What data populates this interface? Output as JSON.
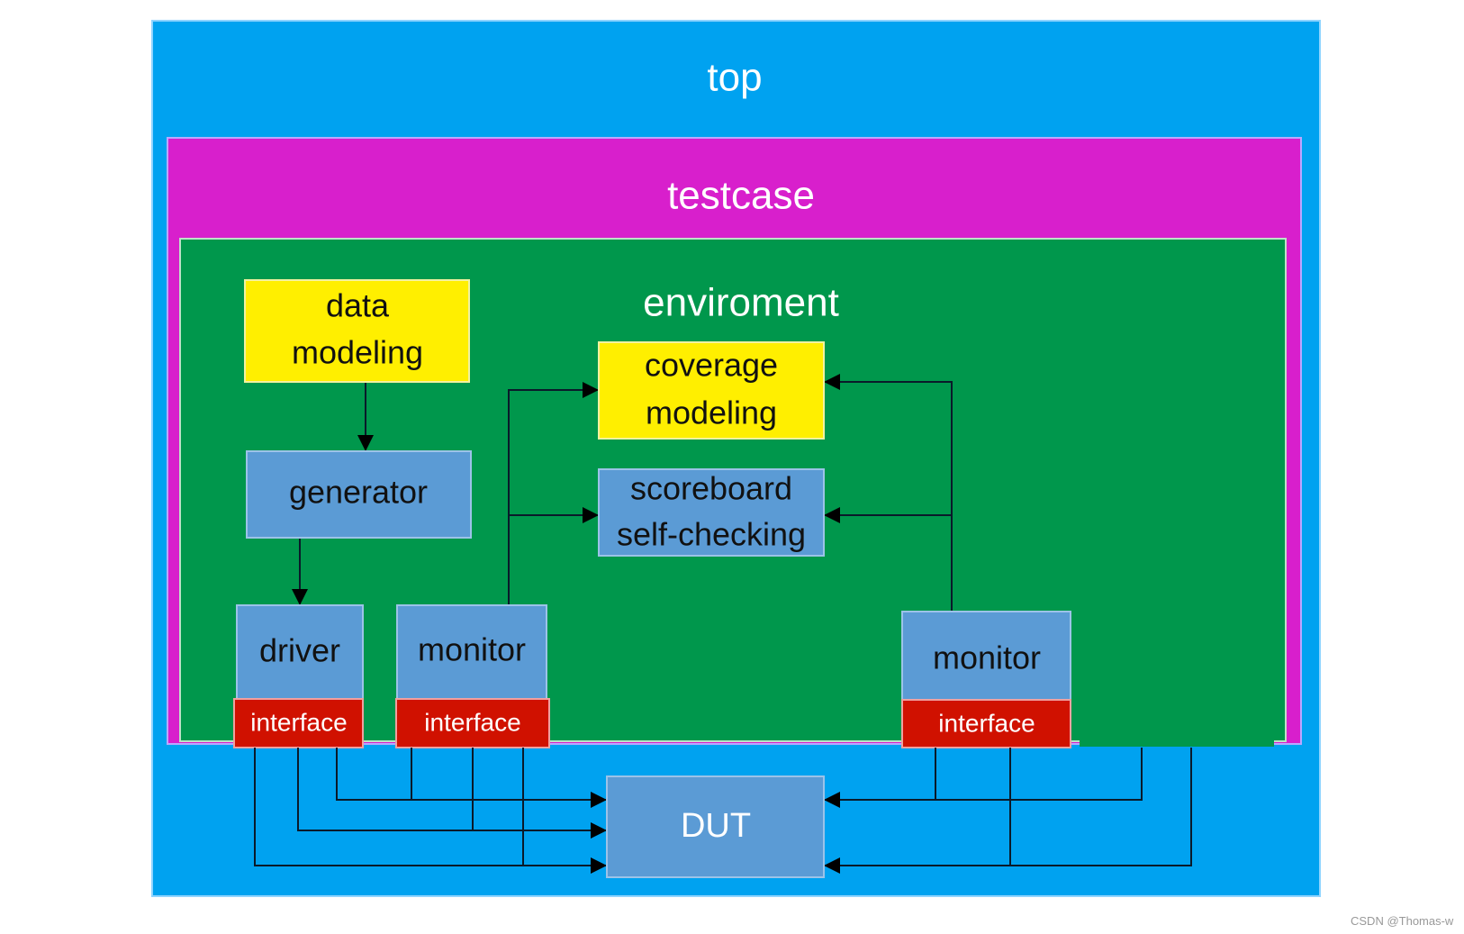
{
  "containers": {
    "top": "top",
    "testcase": "testcase",
    "environment": "enviroment"
  },
  "blocks": {
    "data_modeling": [
      "data",
      "modeling"
    ],
    "generator": "generator",
    "driver": "driver",
    "monitor_left": "monitor",
    "monitor_right": "monitor",
    "coverage_modeling": [
      "coverage",
      "modeling"
    ],
    "scoreboard": [
      "scoreboard",
      "self-checking"
    ],
    "interface_driver": "interface",
    "interface_monitor_left": "interface",
    "interface_monitor_right": "interface",
    "dut": "DUT"
  },
  "watermark": "CSDN @Thomas-w",
  "colors": {
    "top": "#00a2f0",
    "testcase": "#d81fcc",
    "environment": "#00974c",
    "modeling": "#ffef00",
    "component": "#5b9bd5",
    "interface": "#d01100"
  }
}
